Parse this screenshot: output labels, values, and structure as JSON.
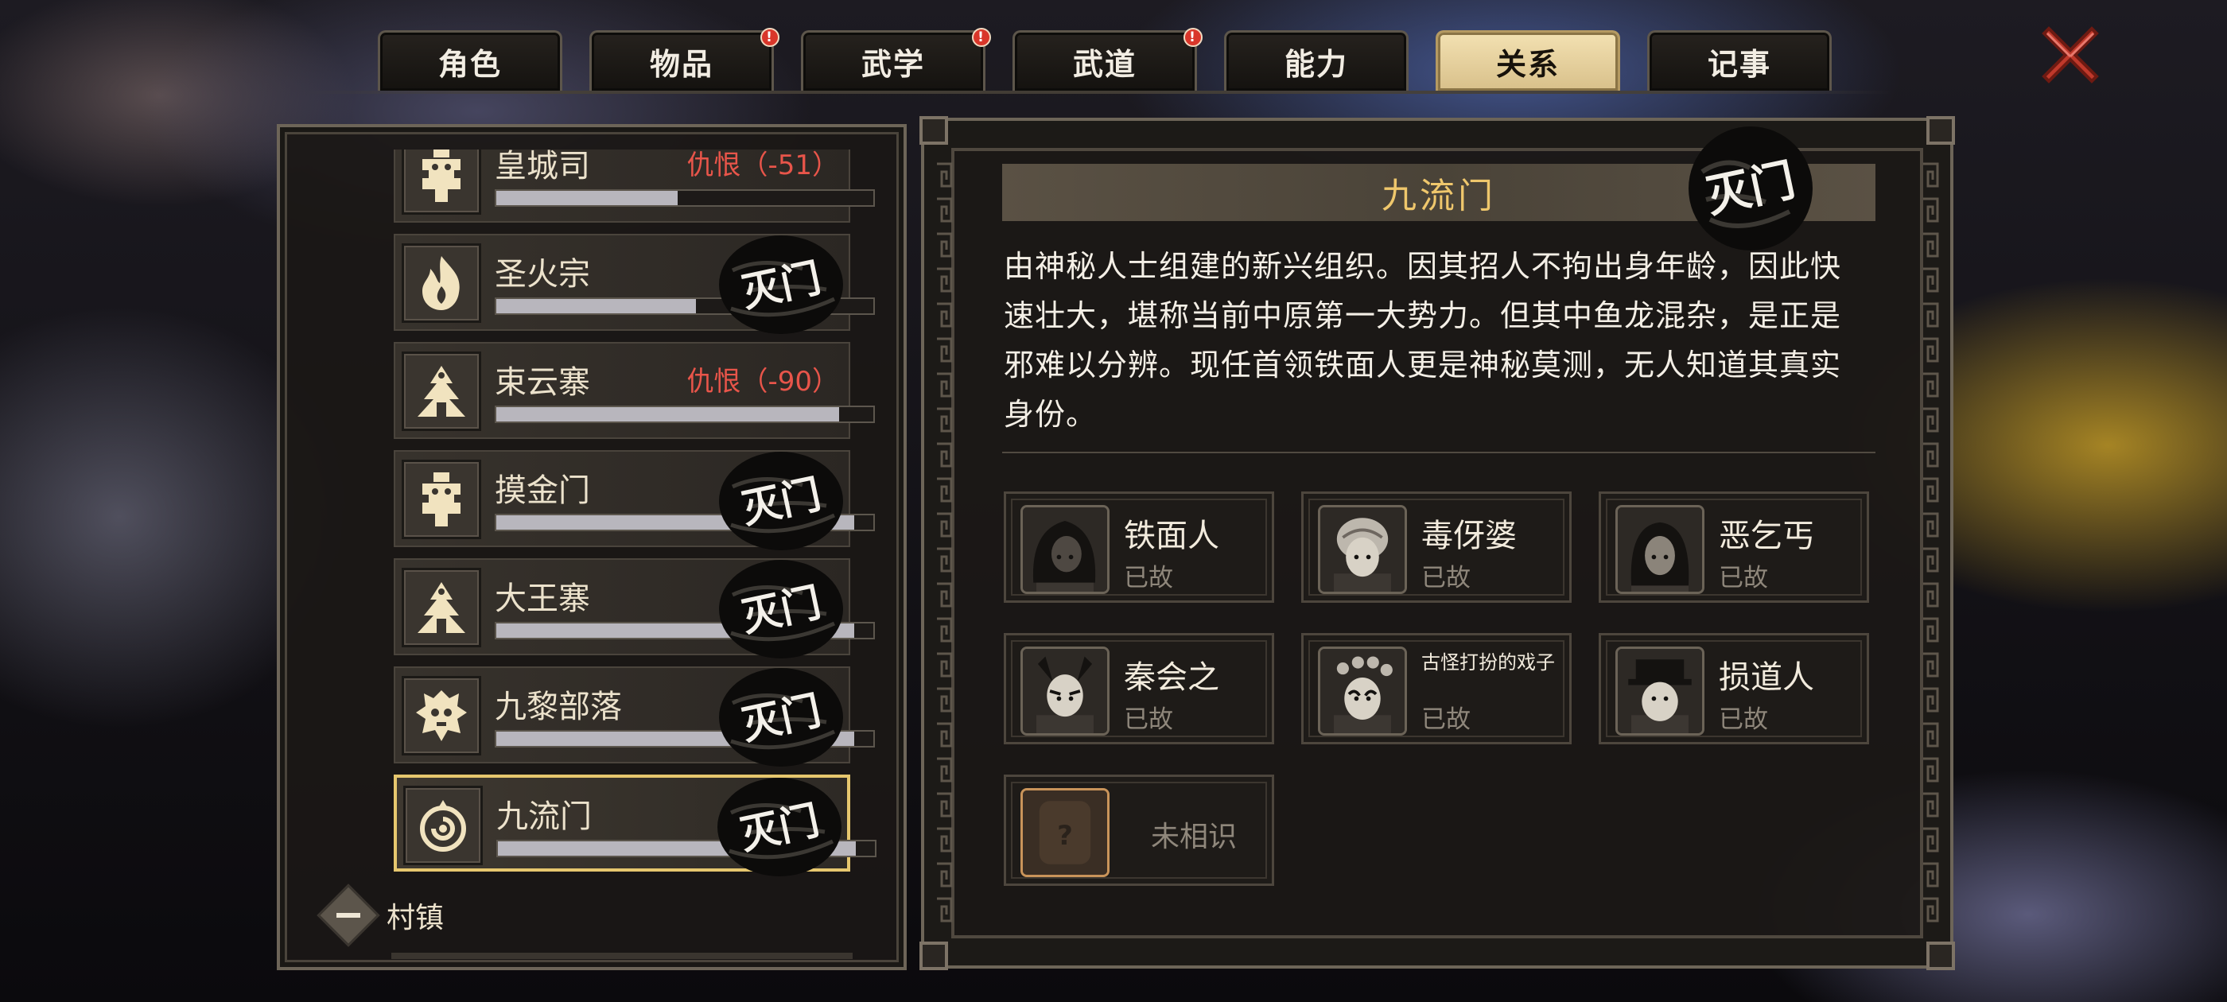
{
  "tabs": [
    {
      "label": "角色",
      "badge": false,
      "active": false
    },
    {
      "label": "物品",
      "badge": true,
      "active": false
    },
    {
      "label": "武学",
      "badge": true,
      "active": false
    },
    {
      "label": "武道",
      "badge": true,
      "active": false
    },
    {
      "label": "能力",
      "badge": false,
      "active": false
    },
    {
      "label": "关系",
      "badge": false,
      "active": true
    },
    {
      "label": "记事",
      "badge": false,
      "active": false
    }
  ],
  "badge_text": "!",
  "stamp_text": "灭门",
  "factions": [
    {
      "name": "皇城司",
      "hate": "仇恨（-51）",
      "relation": 0.48,
      "destroyed": false,
      "icon": "totem-emblem-icon"
    },
    {
      "name": "圣火宗",
      "hate": "",
      "relation": 0.53,
      "destroyed": true,
      "icon": "flame-emblem-icon"
    },
    {
      "name": "束云寨",
      "hate": "仇恨（-90）",
      "relation": 0.91,
      "destroyed": false,
      "icon": "camp-emblem-icon"
    },
    {
      "name": "摸金门",
      "hate": "",
      "relation": 0.95,
      "destroyed": true,
      "icon": "totem-emblem-icon"
    },
    {
      "name": "大王寨",
      "hate": "",
      "relation": 0.95,
      "destroyed": true,
      "icon": "camp-emblem-icon"
    },
    {
      "name": "九黎部落",
      "hate": "",
      "relation": 0.95,
      "destroyed": true,
      "icon": "beast-emblem-icon"
    },
    {
      "name": "九流门",
      "hate": "",
      "relation": 0.95,
      "destroyed": true,
      "icon": "swirl-emblem-icon",
      "selected": true
    }
  ],
  "section_label": "村镇",
  "detail": {
    "title": "九流门",
    "description": "由神秘人士组建的新兴组织。因其招人不拘出身年龄，因此快速壮大，堪称当前中原第一大势力。但其中鱼龙混杂，是正是邪难以分辨。现任首领铁面人更是神秘莫测，无人知道其真实身份。",
    "members": [
      {
        "name": "铁面人",
        "status": "已故",
        "small": false,
        "icon": "hooded-portrait-icon"
      },
      {
        "name": "毒伢婆",
        "status": "已故",
        "small": false,
        "icon": "old-woman-portrait-icon"
      },
      {
        "name": "恶乞丐",
        "status": "已故",
        "small": false,
        "icon": "beggar-portrait-icon"
      },
      {
        "name": "秦会之",
        "status": "已故",
        "small": false,
        "icon": "masked-portrait-icon"
      },
      {
        "name": "古怪打扮的戏子",
        "status": "已故",
        "small": true,
        "icon": "opera-portrait-icon"
      },
      {
        "name": "损道人",
        "status": "已故",
        "small": false,
        "icon": "taoist-portrait-icon"
      }
    ],
    "unknown_label": "未相识"
  },
  "colors": {
    "accent_gold": "#efc76c",
    "hate_red": "#e8554a",
    "selected_border": "#e6c76e",
    "close_red": "#c0392b"
  }
}
